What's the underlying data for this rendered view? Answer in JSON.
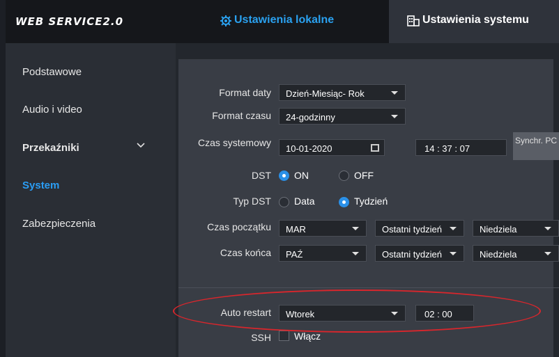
{
  "brand": "WEB SERVICE2.0",
  "tabs": {
    "local": "Ustawienia lokalne",
    "system": "Ustawienia systemu"
  },
  "sidebar": {
    "items": [
      {
        "label": "Podstawowe"
      },
      {
        "label": "Audio i video"
      },
      {
        "label": "Przekaźniki"
      },
      {
        "label": "System"
      },
      {
        "label": "Zabezpieczenia"
      }
    ]
  },
  "form": {
    "date_format_label": "Format daty",
    "date_format_value": "Dzień-Miesiąc- Rok",
    "time_format_label": "Format czasu",
    "time_format_value": "24-godzinny",
    "system_time_label": "Czas systemowy",
    "system_date_value": "10-01-2020",
    "system_time_value": "14  :  37  :  07",
    "sync_button": "Synchr. PC",
    "dst_label": "DST",
    "dst_on": "ON",
    "dst_off": "OFF",
    "dst_type_label": "Typ DST",
    "dst_type_date": "Data",
    "dst_type_week": "Tydzień",
    "start_label": "Czas początku",
    "start_month": "MAR",
    "start_week": "Ostatni tydzień",
    "start_day": "Niedziela",
    "end_label": "Czas końca",
    "end_month": "PAŹ",
    "end_week": "Ostatni tydzień",
    "end_day": "Niedziela",
    "auto_restart_label": "Auto restart",
    "auto_restart_day": "Wtorek",
    "auto_restart_time": "02  :  00",
    "ssh_label": "SSH",
    "ssh_enable": "Włącz"
  },
  "colors": {
    "accent": "#2a9df4",
    "highlight": "#d9262c"
  }
}
